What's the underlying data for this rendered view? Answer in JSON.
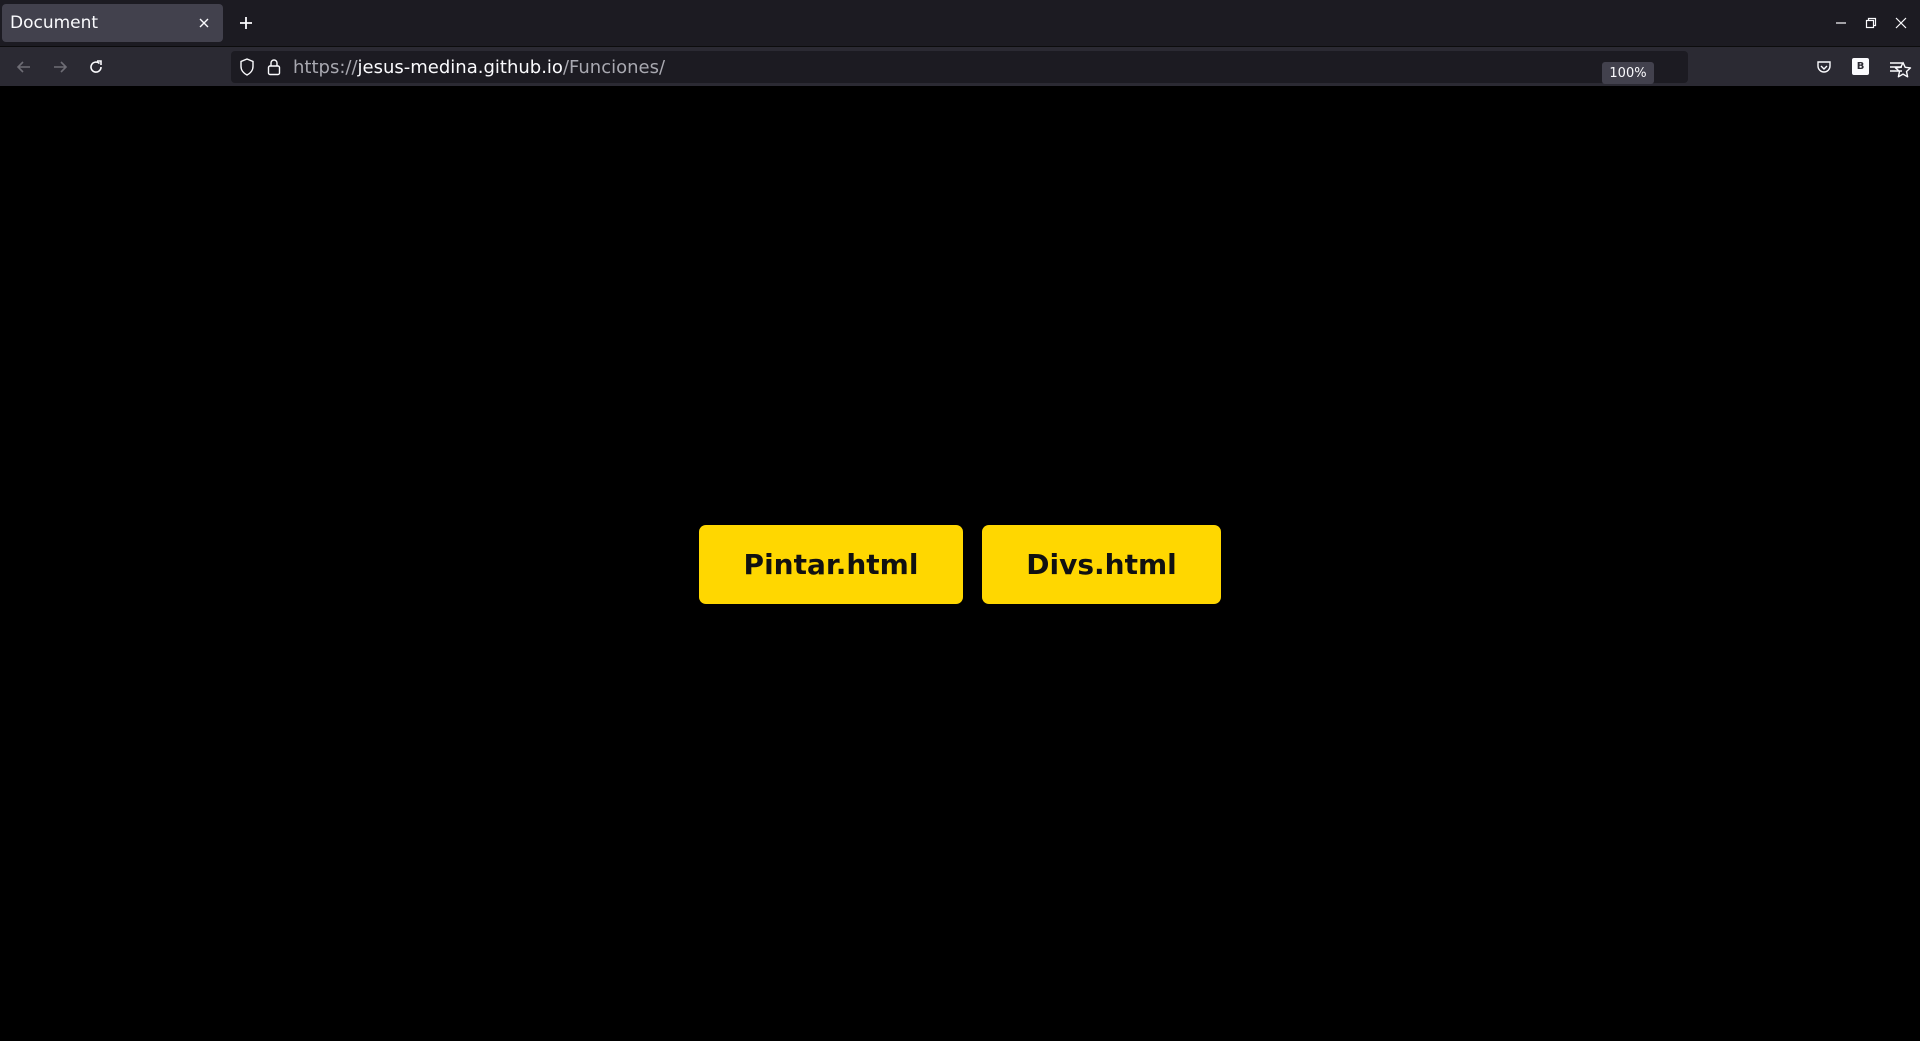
{
  "browser": {
    "tab_title": "Document",
    "url_scheme": "https://",
    "url_host": "jesus-medina.github.io",
    "url_path": "/Funciones/",
    "zoom_level": "100%",
    "extension_badge": "B",
    "icons": [
      "close-icon",
      "plus-icon",
      "minimize-icon",
      "restore-icon",
      "window-close-icon",
      "back-arrow-icon",
      "forward-arrow-icon",
      "reload-icon",
      "shield-icon",
      "lock-icon",
      "star-icon",
      "pocket-icon",
      "menu-icon"
    ]
  },
  "page": {
    "background": "#000000",
    "accent": "#ffd700",
    "buttons": [
      {
        "label": "Pintar.html"
      },
      {
        "label": "Divs.html"
      }
    ]
  }
}
